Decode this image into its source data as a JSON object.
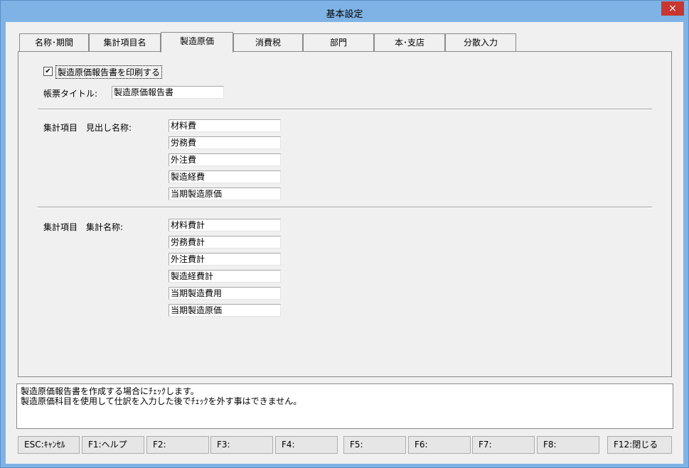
{
  "window": {
    "title": "基本設定",
    "close_glyph": "×"
  },
  "tabs": [
    "名称･期間",
    "集計項目名",
    "製造原価",
    "消費税",
    "部門",
    "本･支店",
    "分散入力"
  ],
  "print_checkbox": {
    "label": "製造原価報告書を印刷する",
    "checked": true,
    "mark": "✔"
  },
  "report_title": {
    "label": "帳票タイトル:",
    "value": "製造原価報告書"
  },
  "heading_names": {
    "label": "集計項目　見出し名称:",
    "values": [
      "材料費",
      "労務費",
      "外注費",
      "製造経費",
      "当期製造原価"
    ]
  },
  "total_names": {
    "label": "集計項目　集計名称:",
    "values": [
      "材料費計",
      "労務費計",
      "外注費計",
      "製造経費計",
      "当期製造費用",
      "当期製造原価"
    ]
  },
  "message": [
    "製造原価報告書を作成する場合にﾁｪｯｸします。",
    "製造原価科目を使用して仕訳を入力した後でﾁｪｯｸを外す事はできません。"
  ],
  "function_keys": [
    "ESC:ｷｬﾝｾﾙ",
    "F1:ヘルプ",
    "F2:",
    "F3:",
    "F4:",
    "F5:",
    "F6:",
    "F7:",
    "F8:",
    "F12:閉じる"
  ]
}
